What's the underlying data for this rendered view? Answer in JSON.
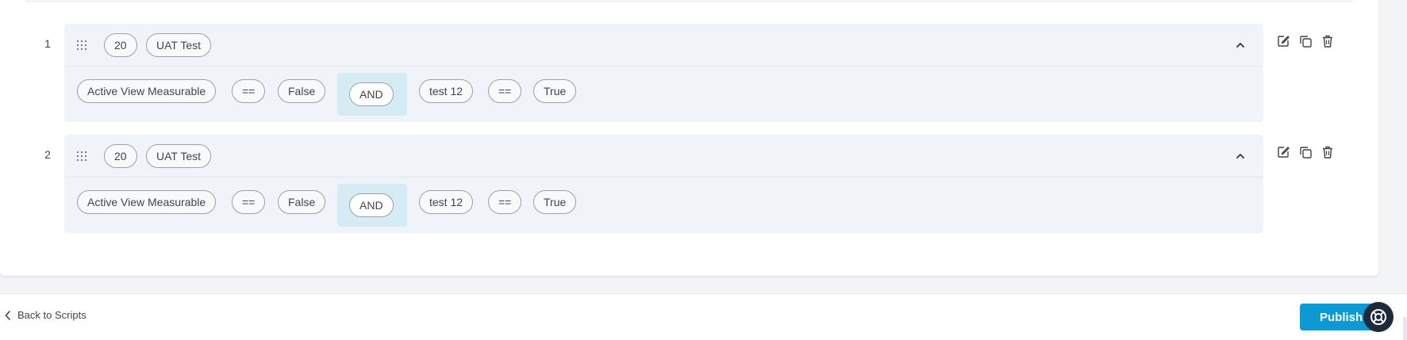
{
  "rules": [
    {
      "number": "1",
      "head": {
        "priority": "20",
        "name": "UAT Test"
      },
      "conditions": [
        {
          "field": "Active View Measurable",
          "op": "==",
          "value": "False"
        },
        {
          "logic": "AND"
        },
        {
          "field": "test 12",
          "op": "==",
          "value": "True"
        }
      ]
    },
    {
      "number": "2",
      "head": {
        "priority": "20",
        "name": "UAT Test"
      },
      "conditions": [
        {
          "field": "Active View Measurable",
          "op": "==",
          "value": "False"
        },
        {
          "logic": "AND"
        },
        {
          "field": "test 12",
          "op": "==",
          "value": "True"
        }
      ]
    }
  ],
  "footer": {
    "back_label": "Back to Scripts",
    "publish_label": "Publish"
  },
  "colors": {
    "accent": "#0b9ad3",
    "and_highlight": "#d6ecf5",
    "rule_bg": "#f0f4f8",
    "help_bg": "#1d2a3a"
  },
  "icons": {
    "drag": "drag-handle-icon",
    "collapse": "chevron-up-icon",
    "edit": "edit-icon",
    "copy": "copy-icon",
    "delete": "trash-icon",
    "back": "chevron-left-icon",
    "help": "help-lifebuoy-icon"
  }
}
